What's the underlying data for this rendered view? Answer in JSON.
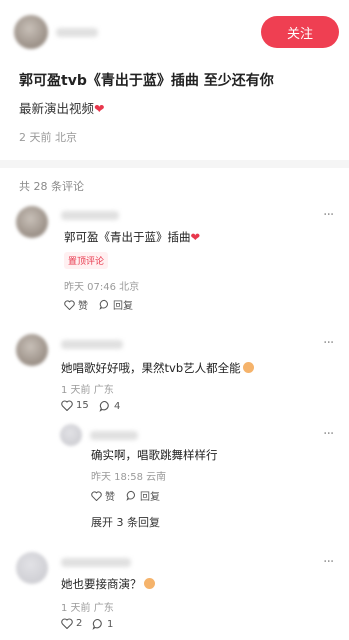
{
  "post": {
    "follow_label": "关注",
    "title": "郭可盈tvb《青出于蓝》插曲 至少还有你",
    "description": "最新演出视频",
    "meta": "2 天前 北京"
  },
  "comments_header": {
    "count_label": "共 28 条评论"
  },
  "comments": [
    {
      "text": "郭可盈《青出于蓝》插曲",
      "pin_label": "置顶评论",
      "meta": "昨天 07:46 北京",
      "like_label": "赞",
      "reply_label": "回复"
    },
    {
      "text": "她唱歌好好哦，果然tvb艺人都全能",
      "meta": "1 天前 广东",
      "like_count": "15",
      "reply_count": "4"
    },
    {
      "text": "确实啊，唱歌跳舞样样行",
      "meta": "昨天 18:58 云南",
      "like_label": "赞",
      "reply_label": "回复",
      "expand_label": "展开 3 条回复"
    },
    {
      "text": "她也要接商演？",
      "meta": "1 天前 广东",
      "like_count": "2",
      "reply_count": "1"
    }
  ],
  "icons": {
    "heart": "heart-icon",
    "comment": "comment-bubble-icon",
    "more": "more-dots-icon"
  },
  "colors": {
    "accent": "#ef3f52",
    "heart": "#e8384d"
  }
}
